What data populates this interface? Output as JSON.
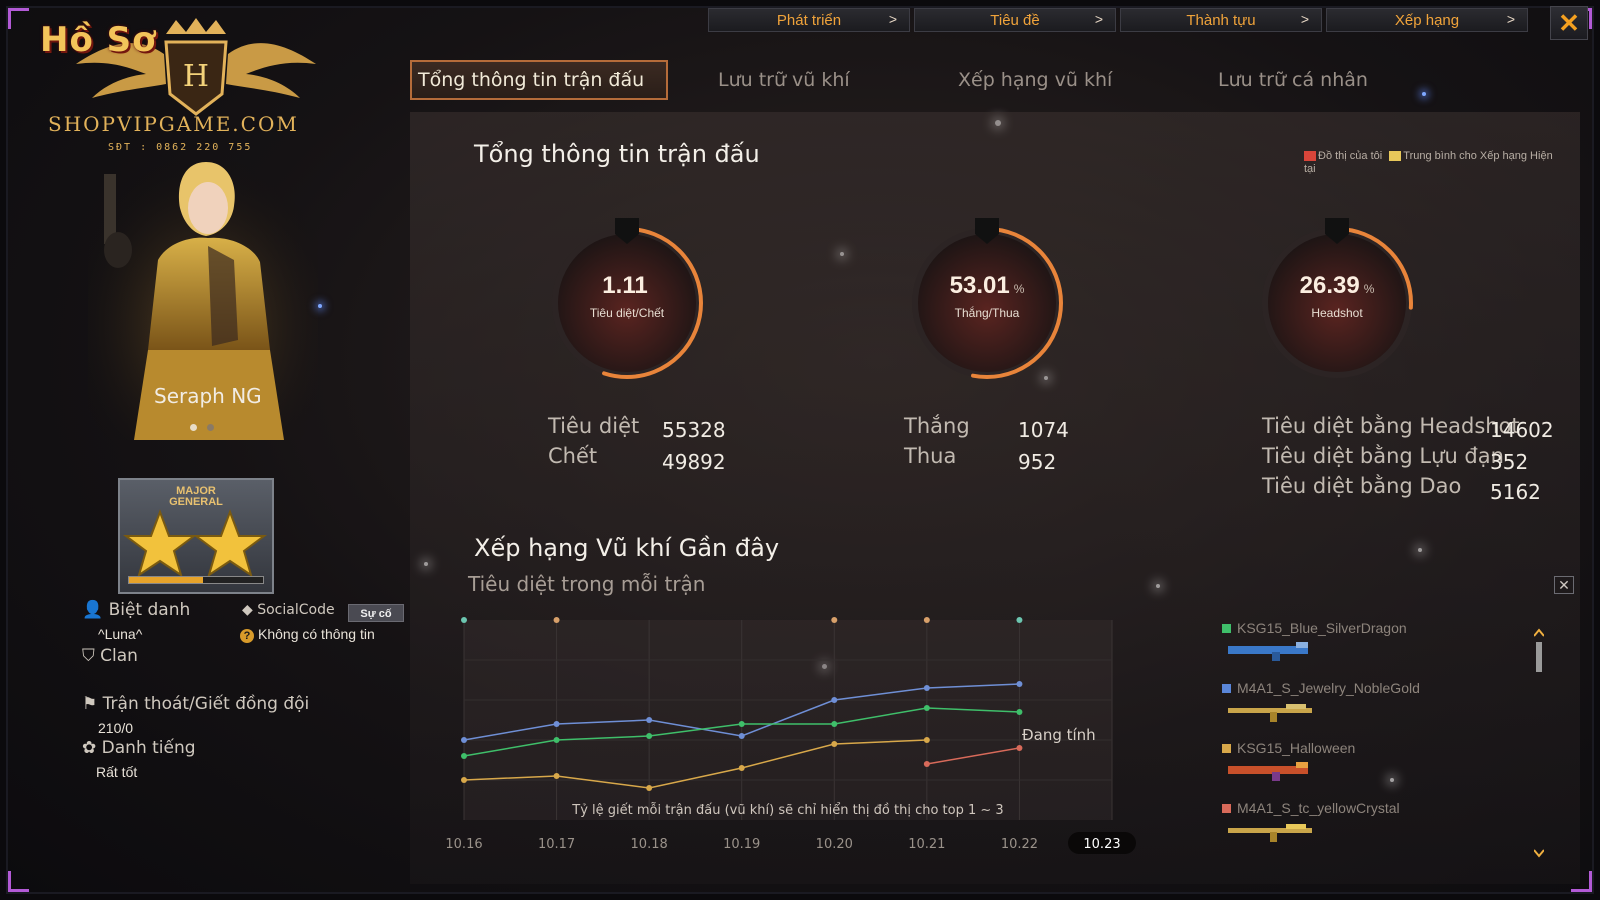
{
  "topnav": [
    {
      "label": "Phát triển"
    },
    {
      "label": "Tiêu đề"
    },
    {
      "label": "Thành tựu"
    },
    {
      "label": "Xếp hạng"
    }
  ],
  "logo": {
    "title": "Hồ Sơ",
    "site": "SHOPVIPGAME.COM",
    "phone": "SĐT : 0862 220 755"
  },
  "character": {
    "name": "Seraph NG"
  },
  "rank": {
    "line1": "MAJOR",
    "line2": "GENERAL",
    "progress": 0.55
  },
  "profile": {
    "nickname_label": "Biệt danh",
    "nickname": "^Luna^",
    "socialcode_label": "SocialCode",
    "incident_button": "Sự cố",
    "no_info": "Không có thông tin",
    "clan_label": "Clan",
    "desertion_label": "Trận thoát/Giết đồng đội",
    "desertion_value": "210/0",
    "reputation_label": "Danh tiếng",
    "reputation_value": "Rất tốt"
  },
  "tabs": [
    {
      "label": "Tổng thông tin trận đấu",
      "active": true
    },
    {
      "label": "Lưu trữ vũ khí"
    },
    {
      "label": "Xếp hạng vũ khí"
    },
    {
      "label": "Lưu trữ cá nhân"
    }
  ],
  "summary": {
    "title": "Tổng thông tin trận đấu",
    "legend_mine": "Đồ thị của tôi",
    "legend_avg": "Trung bình cho Xếp hạng Hiện tại",
    "gauges": [
      {
        "value": "1.11",
        "unit": "",
        "label": "Tiêu diệt/Chết",
        "fill": 0.55
      },
      {
        "value": "53.01",
        "unit": "%",
        "label": "Thắng/Thua",
        "fill": 0.53
      },
      {
        "value": "26.39",
        "unit": "%",
        "label": "Headshot",
        "fill": 0.26
      }
    ],
    "stats": {
      "kills_label": "Tiêu diệt",
      "kills": "55328",
      "deaths_label": "Chết",
      "deaths": "49892",
      "wins_label": "Thắng",
      "wins": "1074",
      "losses_label": "Thua",
      "losses": "952",
      "hs_label": "Tiêu diệt bằng Headshot",
      "hs": "14602",
      "grenade_label": "Tiêu diệt bằng Lựu đạn",
      "grenade": "352",
      "knife_label": "Tiêu diệt bằng Dao",
      "knife": "5162"
    }
  },
  "weapon_ranking": {
    "title": "Xếp hạng Vũ khí Gần đây",
    "subtitle": "Tiêu diệt trong mỗi trận",
    "note": "Tỷ lệ giết mỗi trận đấu (vũ khí) sẽ chỉ hiển thị đồ thị cho top 1 ~ 3",
    "calculating": "Đang tính",
    "close": "✕"
  },
  "weapons": [
    {
      "name": "KSG15_Blue_SilverDragon",
      "color": "#3fbf6a"
    },
    {
      "name": "M4A1_S_Jewelry_NobleGold",
      "color": "#5a86d8"
    },
    {
      "name": "KSG15_Halloween",
      "color": "#d8a84a"
    },
    {
      "name": "M4A1_S_tc_yellowCrystal",
      "color": "#d86a5a"
    }
  ],
  "chart_data": {
    "type": "line",
    "categories": [
      "10.16",
      "10.17",
      "10.18",
      "10.19",
      "10.20",
      "10.21",
      "10.22",
      "10.23"
    ],
    "selected_category": "10.23",
    "series": [
      {
        "color": "#6f8fd6",
        "values": [
          0.4,
          0.48,
          0.5,
          0.42,
          0.6,
          0.66,
          0.68,
          null
        ]
      },
      {
        "color": "#3fbf6a",
        "values": [
          0.32,
          0.4,
          0.42,
          0.48,
          0.48,
          0.56,
          0.54,
          null
        ]
      },
      {
        "color": "#d8a84a",
        "values": [
          0.2,
          0.22,
          0.16,
          0.26,
          0.38,
          0.4,
          null,
          null
        ]
      },
      {
        "color": "#d86a5a",
        "values": [
          null,
          null,
          null,
          null,
          null,
          0.28,
          0.36,
          null
        ]
      }
    ],
    "top_markers": [
      {
        "category": "10.16",
        "color": "#6cc6b0"
      },
      {
        "category": "10.17",
        "color": "#d8a06a"
      },
      {
        "category": "10.20",
        "color": "#d8a06a"
      },
      {
        "category": "10.21",
        "color": "#d8a06a"
      },
      {
        "category": "10.22",
        "color": "#6cc6b0"
      }
    ],
    "ylim": [
      0,
      1
    ],
    "grid": true
  }
}
